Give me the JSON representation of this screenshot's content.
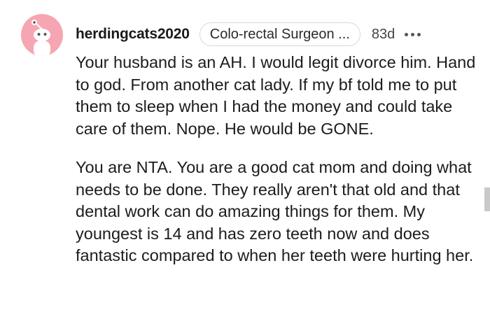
{
  "comment": {
    "username": "herdingcats2020",
    "flair": "Colo-rectal Surgeon ...",
    "age": "83d",
    "more_icon": "more-options-icon",
    "avatar_icon": "snoo-avatar-icon",
    "paragraphs": [
      "Your husband is an AH. I would legit divorce him. Hand to god. From another cat lady. If my bf told me to put them to sleep when I had the money and could take care of them. Nope. He would be GONE.",
      "You are NTA. You are a good cat mom and doing what needs to be done. They really aren't that old and that dental work can do amazing things for them. My youngest is 14 and has zero teeth now and does fantastic compared to when her teeth were hurting her."
    ]
  },
  "colors": {
    "avatar_bg": "#f6a6b2",
    "text": "#1c1c1c",
    "flair_border": "#d7d7d7"
  }
}
